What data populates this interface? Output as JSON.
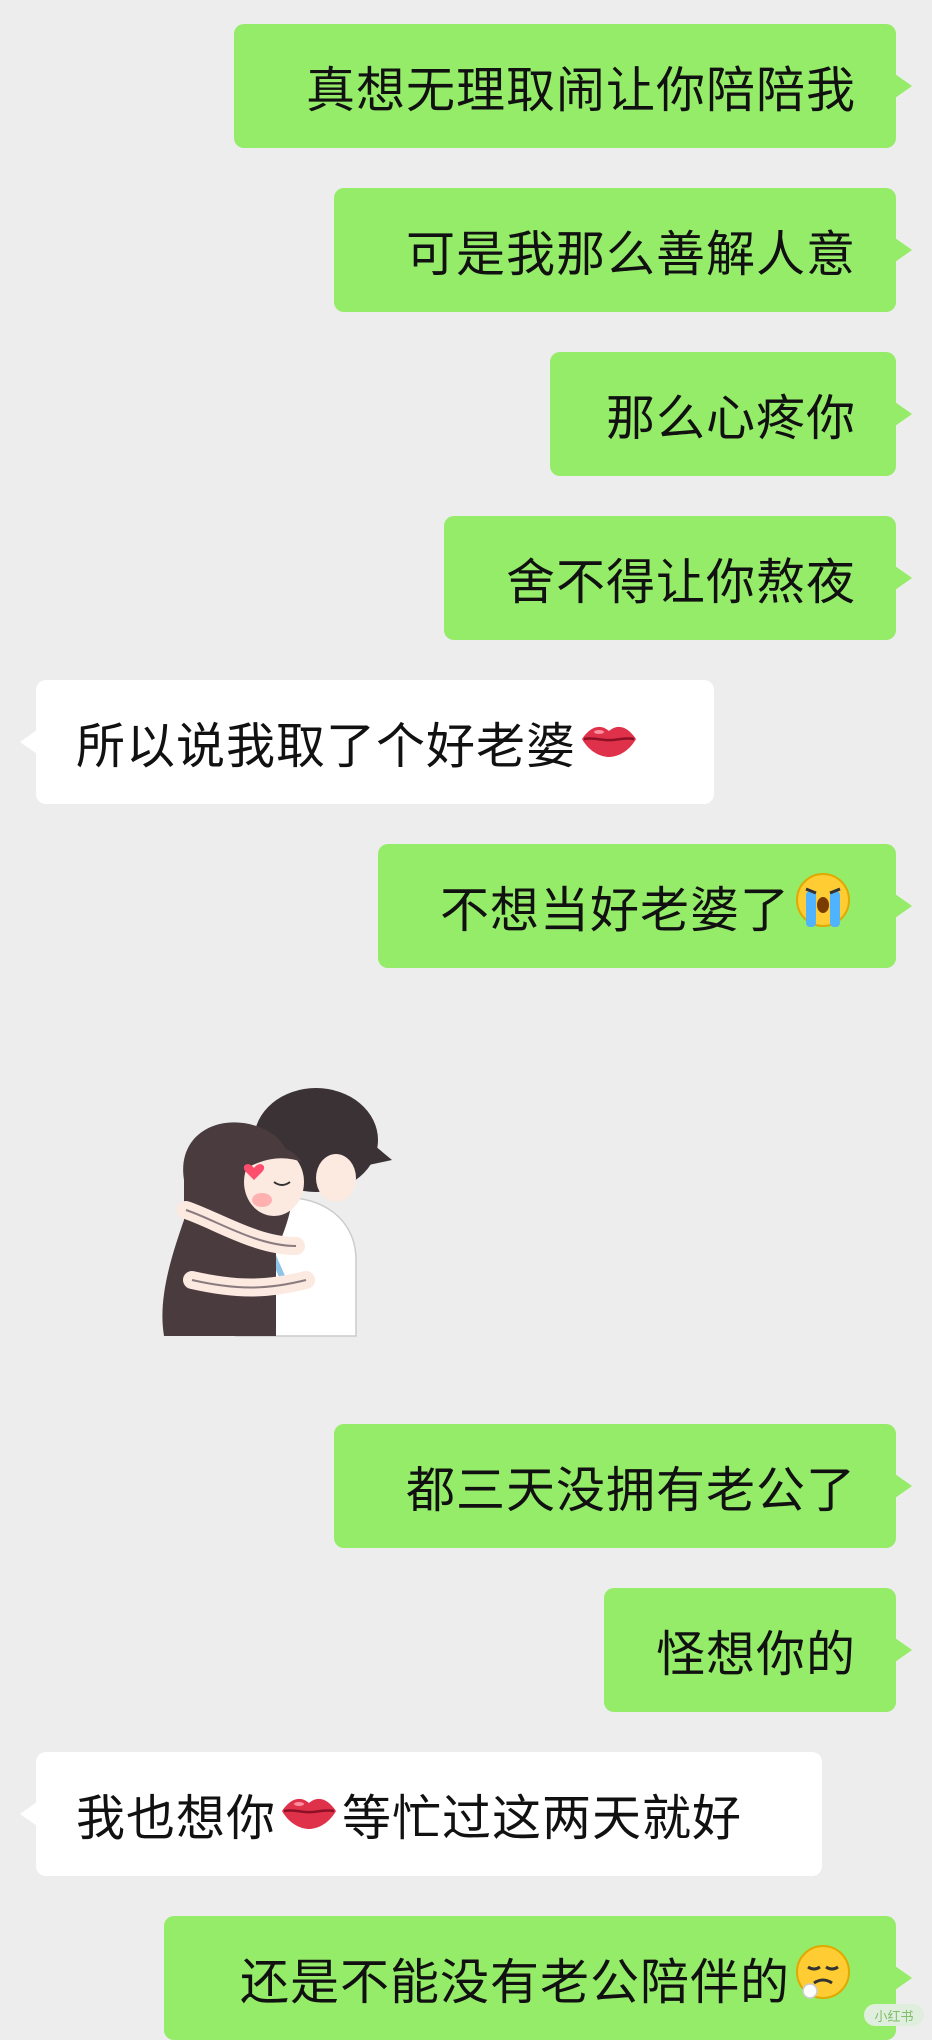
{
  "messages": [
    {
      "side": "out",
      "text": "真想无理取闹让你陪陪我"
    },
    {
      "side": "out",
      "text": "可是我那么善解人意"
    },
    {
      "side": "out",
      "text": "那么心疼你"
    },
    {
      "side": "out",
      "text": "舍不得让你熬夜"
    },
    {
      "side": "in",
      "text": "所以说我取了个好老婆",
      "emoji": "kiss-lips-icon"
    },
    {
      "side": "out",
      "text": "不想当好老婆了",
      "emoji": "crying-face-icon"
    },
    {
      "side": "in",
      "sticker": "hugging-couple-sticker"
    },
    {
      "side": "out",
      "text": "都三天没拥有老公了"
    },
    {
      "side": "out",
      "text": "怪想你的"
    },
    {
      "side": "in",
      "text_before": "我也想你",
      "emoji": "kiss-lips-icon",
      "text_after": "等忙过这两天就好"
    },
    {
      "side": "out",
      "text": "还是不能没有老公陪伴的",
      "emoji": "sad-sigh-face-icon"
    }
  ],
  "colors": {
    "background": "#ededed",
    "outgoing_bubble": "#95ec69",
    "incoming_bubble": "#ffffff"
  },
  "watermark": {
    "text": "小红书"
  }
}
